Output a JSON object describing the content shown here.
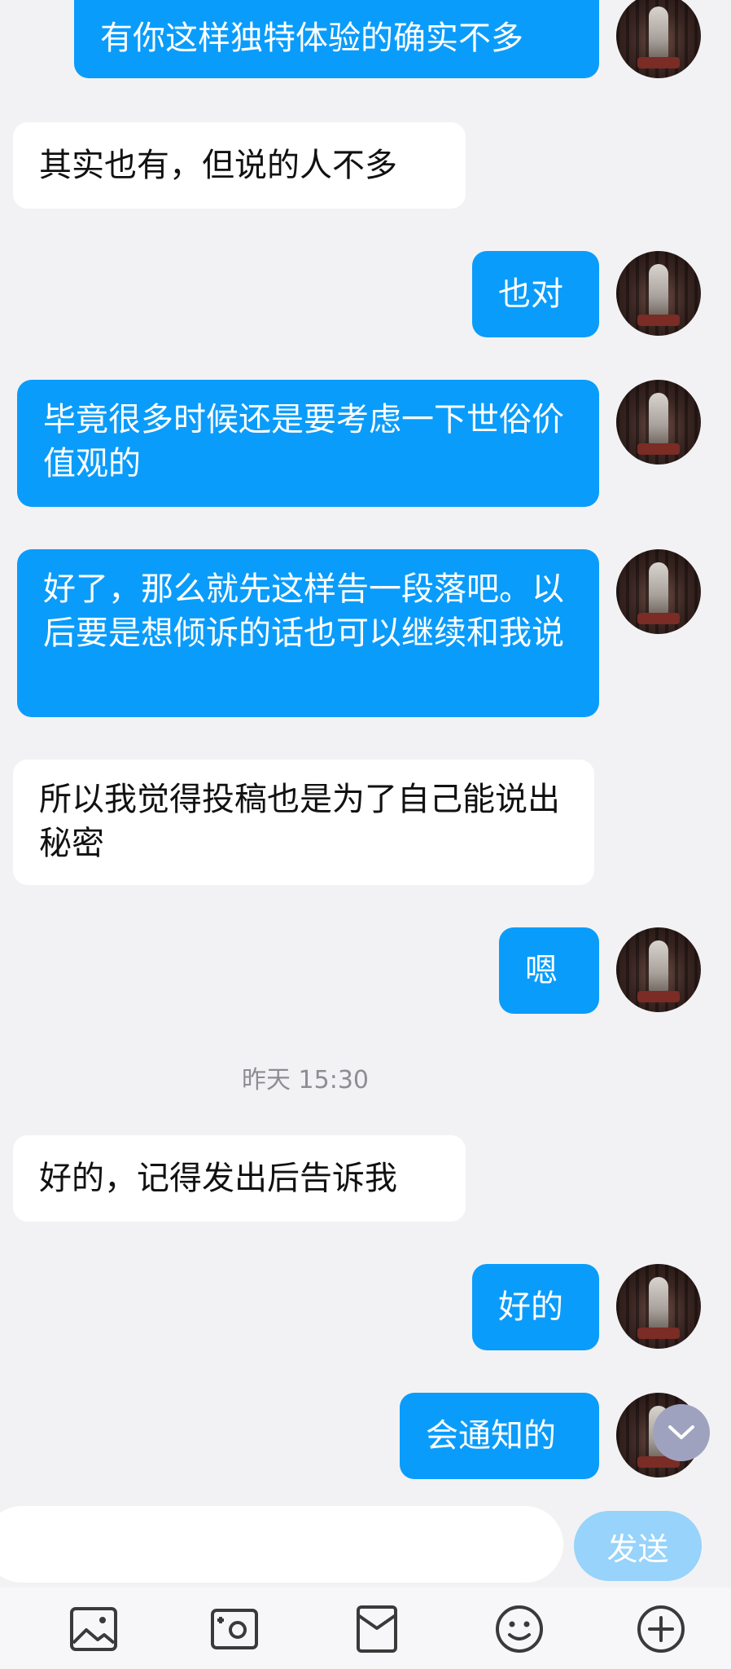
{
  "messages": [
    {
      "text": "有你这样独特体验的确实不多",
      "side": "out"
    },
    {
      "text": "其实也有，但说的人不多",
      "side": "in"
    },
    {
      "text": "也对",
      "side": "out"
    },
    {
      "text": "毕竟很多时候还是要考虑一下世俗价值观的",
      "side": "out"
    },
    {
      "text": "好了，那么就先这样告一段落吧。以后要是想倾诉的话也可以继续和我说",
      "side": "out"
    },
    {
      "text": "所以我觉得投稿也是为了自己能说出秘密",
      "side": "in"
    },
    {
      "text": "嗯",
      "side": "out"
    },
    {
      "text": "好的，记得发出后告诉我",
      "side": "in"
    },
    {
      "text": "好的",
      "side": "out"
    },
    {
      "text": "会通知的",
      "side": "out"
    }
  ],
  "timestamp": "昨天 15:30",
  "input": {
    "value": "",
    "placeholder": ""
  },
  "send_label": "发送",
  "toolbar_icons": [
    "image-icon",
    "camera-icon",
    "red-packet-icon",
    "emoji-icon",
    "plus-icon"
  ],
  "colors": {
    "outgoing_bubble": "#0a9cfb",
    "incoming_bubble": "#ffffff",
    "background": "#f2f2f4",
    "send_button": "#97d3fb",
    "scroll_button": "#9fa2bf"
  }
}
